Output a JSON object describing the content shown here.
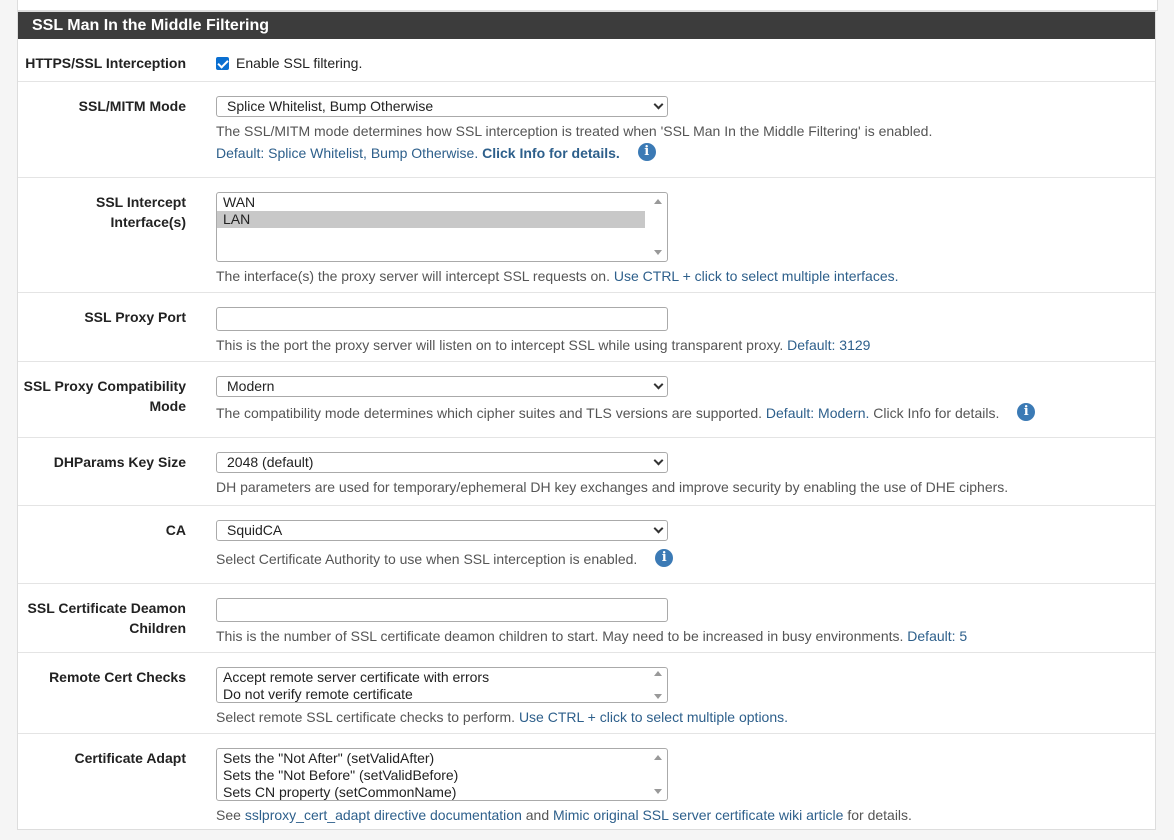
{
  "panel": {
    "title": "SSL Man In the Middle Filtering"
  },
  "rows": {
    "interception": {
      "label": "HTTPS/SSL Interception",
      "checkbox_label": "Enable SSL filtering."
    },
    "mitm_mode": {
      "label": "SSL/MITM Mode",
      "selected": "Splice Whitelist, Bump Otherwise",
      "help1": "The SSL/MITM mode determines how SSL interception is treated when 'SSL Man In the Middle Filtering' is enabled.",
      "help2_default": "Default: Splice Whitelist, Bump Otherwise.",
      "help2_click": "Click Info for details."
    },
    "intercept_interfaces": {
      "label": "SSL Intercept Interface(s)",
      "options": [
        "WAN",
        "LAN"
      ],
      "help_text": "The interface(s) the proxy server will intercept SSL requests on.",
      "help_link": "Use CTRL + click to select multiple interfaces."
    },
    "proxy_port": {
      "label": "SSL Proxy Port",
      "value": "",
      "help_text": "This is the port the proxy server will listen on to intercept SSL while using transparent proxy.",
      "help_default": "Default: 3129"
    },
    "compat_mode": {
      "label_line1": "SSL Proxy Compatibility",
      "label_line2": "Mode",
      "selected": "Modern",
      "help_text": "The compatibility mode determines which cipher suites and TLS versions are supported.",
      "help_default": "Default: Modern.",
      "help_tail": "Click Info for details."
    },
    "dhparams": {
      "label": "DHParams Key Size",
      "selected": "2048 (default)",
      "help_text": "DH parameters are used for temporary/ephemeral DH key exchanges and improve security by enabling the use of DHE ciphers."
    },
    "ca": {
      "label": "CA",
      "selected": "SquidCA",
      "help_text": "Select Certificate Authority to use when SSL interception is enabled."
    },
    "cert_daemon": {
      "label_line1": "SSL Certificate Deamon",
      "label_line2": "Children",
      "value": "",
      "help_text": "This is the number of SSL certificate deamon children to start. May need to be increased in busy environments.",
      "help_default": "Default: 5"
    },
    "remote_checks": {
      "label": "Remote Cert Checks",
      "options": [
        "Accept remote server certificate with errors",
        "Do not verify remote certificate"
      ],
      "help_text": "Select remote SSL certificate checks to perform.",
      "help_link": "Use CTRL + click to select multiple options."
    },
    "cert_adapt": {
      "label": "Certificate Adapt",
      "options": [
        "Sets the \"Not After\" (setValidAfter)",
        "Sets the \"Not Before\" (setValidBefore)",
        "Sets CN property (setCommonName)"
      ],
      "help_see": "See",
      "help_link1": "sslproxy_cert_adapt directive documentation",
      "help_and": "and",
      "help_link2": "Mimic original SSL server certificate wiki article",
      "help_tail": "for details."
    }
  },
  "icons": {
    "info": "info-icon",
    "checkbox": "checkbox-checked-icon",
    "chevron": "chevron-down-icon"
  },
  "colors": {
    "header_bg": "#3c3c3c",
    "link": "#2d5f8b",
    "info": "#3b7ab5",
    "checkbox": "#0a6fd1"
  }
}
